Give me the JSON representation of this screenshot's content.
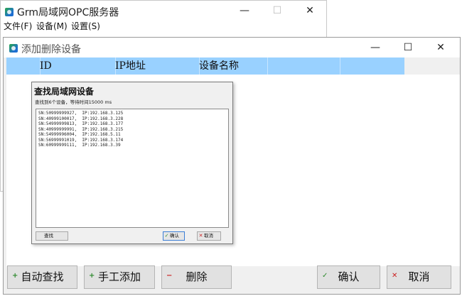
{
  "main_window": {
    "title": "Grm局域网OPC服务器",
    "menu": [
      "文件(F)",
      "设备(M)",
      "设置(S)"
    ],
    "controls": {
      "minimize": "—",
      "maximize": "☐",
      "close": "✕"
    }
  },
  "dialog": {
    "title": "添加删除设备",
    "controls": {
      "minimize": "—",
      "maximize": "☐",
      "close": "✕"
    },
    "columns": [
      "",
      "ID",
      "IP地址",
      "设备名称",
      "",
      ""
    ]
  },
  "find_dialog": {
    "title": "查找局域网设备",
    "status": "查找到6个设备，等待时间15000 ms",
    "results": [
      "SN:50999999927,  IP:192.168.3.125",
      "SN:40999100017,  IP:192.168.3.228",
      "SN:54999999813,  IP:192.168.3.177",
      "SN:40999999991,  IP:192.168.3.215",
      "SN:54999996004,  IP:192.168.5.11",
      "SN:56999991019,  IP:192.168.3.174",
      "SN:60999999111,  IP:192.168.3.39"
    ],
    "buttons": {
      "find": "查找",
      "ok": "确认",
      "cancel": "取消"
    }
  },
  "bottom_buttons": {
    "auto_find": "自动查找",
    "manual_add": "手工添加",
    "delete": "删除",
    "confirm": "确认",
    "cancel": "取消"
  },
  "icons": {
    "plus": "+",
    "minus": "−",
    "check": "✓",
    "cross": "✕"
  }
}
